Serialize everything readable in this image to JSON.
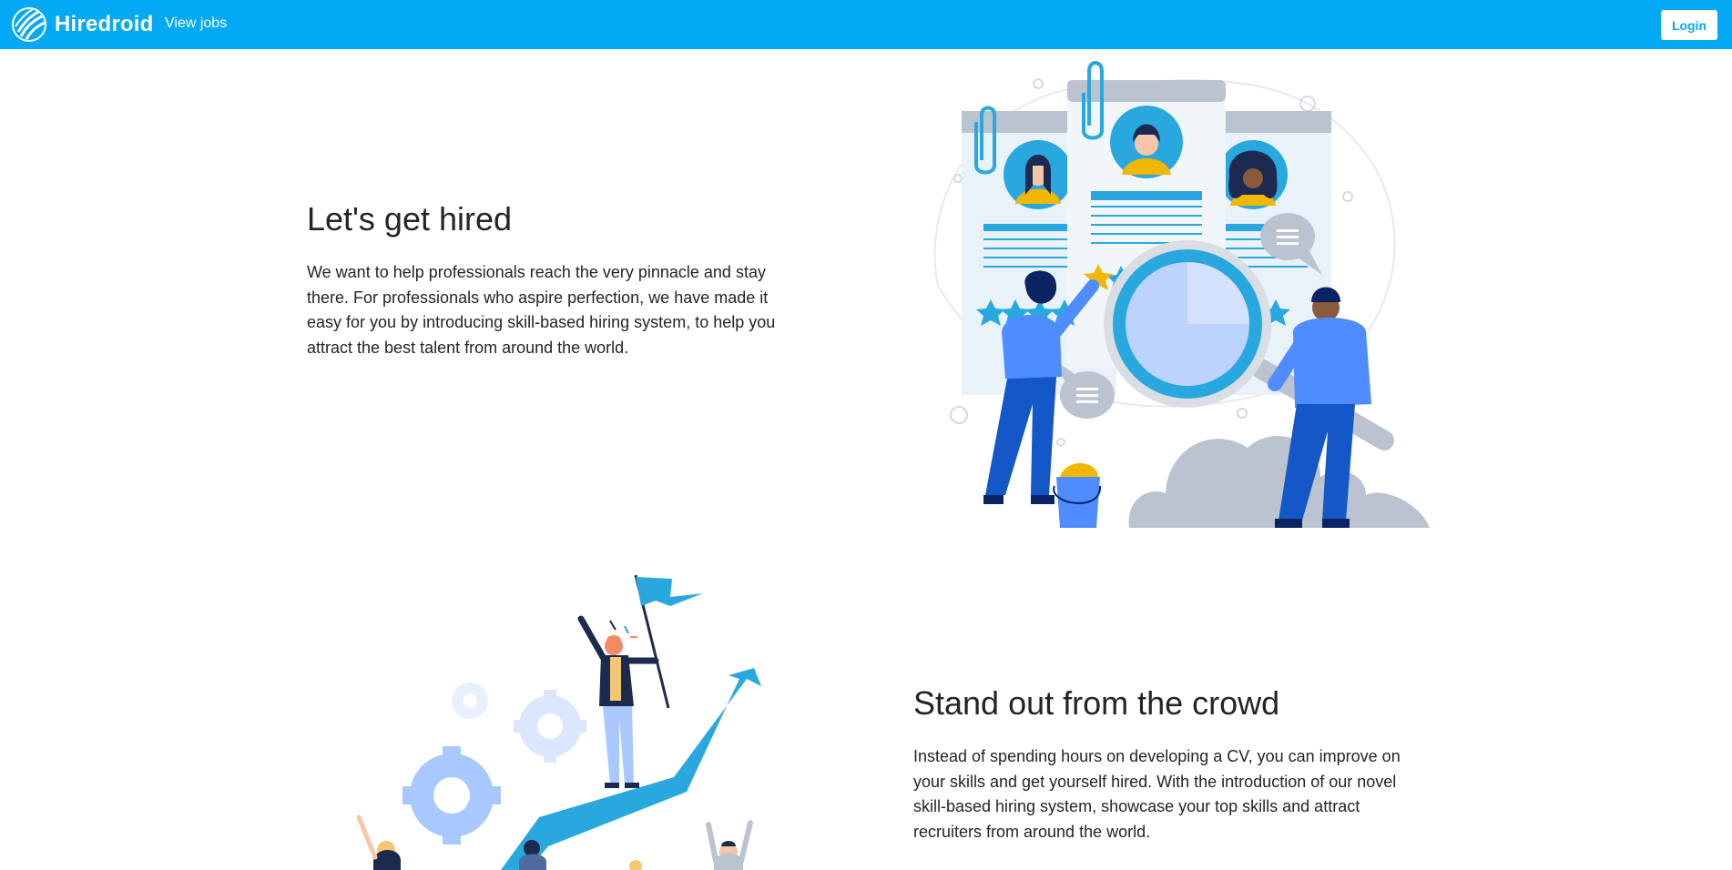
{
  "navbar": {
    "brand": "Hiredroid",
    "logo_icon": "hiredroid-logo-icon",
    "links": [
      {
        "label": "View jobs"
      }
    ],
    "login_label": "Login",
    "background_color": "#03a9f4"
  },
  "hero": {
    "title": "Let's get hired",
    "text": "We want to help professionals reach the very pinnacle and stay there. For professionals who aspire perfection, we have made it easy for you by introducing skill-based hiring system, to help you attract the best talent from around the world.",
    "illustration": "resume-review-illustration"
  },
  "feature": {
    "title": "Stand out from the crowd",
    "text": "Instead of spending hours on developing a CV, you can improve on your skills and get yourself hired. With the introduction of our novel skill-based hiring system, showcase your top skills and attract recruiters from around the world.",
    "illustration": "success-growth-illustration"
  },
  "colors": {
    "accent": "#03a9f4",
    "illustration_blue": "#29a8df",
    "illustration_light_blue": "#a9c8ff",
    "illustration_gray": "#bac3cf"
  }
}
